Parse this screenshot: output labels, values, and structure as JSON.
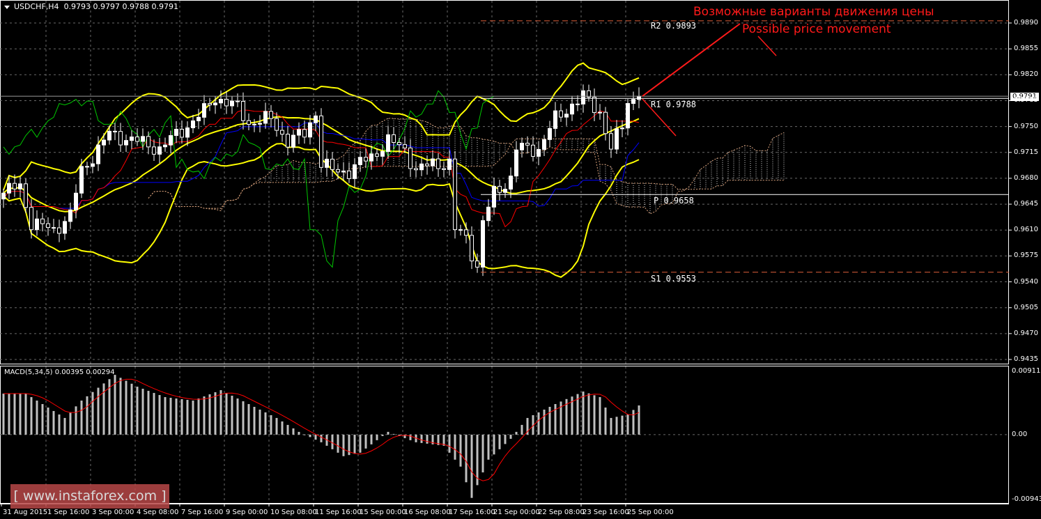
{
  "header": {
    "symbol": "USDCHF,H4",
    "ohlc": "0.9793 0.9797 0.9788 0.9791"
  },
  "annotation": {
    "ru": "Возможные варианты движения цены",
    "en": "Possible price movement"
  },
  "watermark": "[  www.instaforex.com ]",
  "current_price": "0.9791",
  "macd_label": "MACD(5,34,5) 0.00395 0.00294",
  "colors": {
    "bollinger": "#ffff00",
    "tenkan": "#ff0000",
    "kijun": "#0000ff",
    "chikou": "#00c800",
    "levels": "#e0603a",
    "annotation": "#ff1a1a",
    "macd_signal": "#ff0000",
    "macd_hist": "#c0c0c0"
  },
  "chart_data": {
    "type": "candlestick",
    "title": "USDCHF,H4",
    "price_axis": {
      "ticks": [
        "0.9890",
        "0.9855",
        "0.9820",
        "0.9785",
        "0.9750",
        "0.9715",
        "0.9680",
        "0.9645",
        "0.9610",
        "0.9575",
        "0.9540",
        "0.9505",
        "0.9470",
        "0.9435"
      ],
      "range": [
        0.9435,
        0.989
      ]
    },
    "time_axis": {
      "ticks": [
        "31 Aug 2015",
        "1 Sep 16:00",
        "3 Sep 00:00",
        "4 Sep 08:00",
        "7 Sep 16:00",
        "9 Sep 00:00",
        "10 Sep 08:00",
        "11 Sep 16:00",
        "15 Sep 00:00",
        "16 Sep 08:00",
        "17 Sep 16:00",
        "21 Sep 00:00",
        "22 Sep 08:00",
        "23 Sep 16:00",
        "25 Sep 00:00"
      ],
      "bars_per_tick": 8
    },
    "close_keypoints": [
      [
        0,
        0.966
      ],
      [
        3,
        0.967
      ],
      [
        5,
        0.962
      ],
      [
        9,
        0.961
      ],
      [
        12,
        0.963
      ],
      [
        14,
        0.969
      ],
      [
        19,
        0.974
      ],
      [
        24,
        0.973
      ],
      [
        28,
        0.972
      ],
      [
        32,
        0.9745
      ],
      [
        36,
        0.977
      ],
      [
        38,
        0.979
      ],
      [
        42,
        0.9775
      ],
      [
        44,
        0.9755
      ],
      [
        48,
        0.976
      ],
      [
        51,
        0.973
      ],
      [
        54,
        0.974
      ],
      [
        56,
        0.977
      ],
      [
        57,
        0.97
      ],
      [
        59,
        0.969
      ],
      [
        62,
        0.969
      ],
      [
        66,
        0.971
      ],
      [
        69,
        0.973
      ],
      [
        72,
        0.972
      ],
      [
        74,
        0.969
      ],
      [
        77,
        0.97
      ],
      [
        80,
        0.97
      ],
      [
        81,
        0.961
      ],
      [
        83,
        0.96
      ],
      [
        85,
        0.956
      ],
      [
        86,
        0.962
      ],
      [
        88,
        0.966
      ],
      [
        91,
        0.968
      ],
      [
        92,
        0.972
      ],
      [
        96,
        0.972
      ],
      [
        99,
        0.976
      ],
      [
        102,
        0.978
      ],
      [
        104,
        0.979
      ],
      [
        107,
        0.977
      ],
      [
        109,
        0.972
      ],
      [
        111,
        0.975
      ],
      [
        112,
        0.9785
      ],
      [
        114,
        0.9791
      ]
    ],
    "levels": [
      {
        "name": "R2",
        "label": "R2 0.9893",
        "value": 0.9893,
        "style": "dashed"
      },
      {
        "name": "R1",
        "label": "R1 0.9788",
        "value": 0.9788,
        "style": "solid"
      },
      {
        "name": "P",
        "label": "P 0.9658",
        "value": 0.9658,
        "style": "solid"
      },
      {
        "name": "S1",
        "label": "S1 0.9553",
        "value": 0.9553,
        "style": "dashed"
      }
    ],
    "indicators": [
      "Bollinger Bands(20,2)",
      "Ichimoku",
      "MACD(5,34,5)"
    ],
    "macd": {
      "axis_ticks": [
        "0.00911",
        "0.00",
        "-0.00943"
      ],
      "range": [
        -0.00943,
        0.00911
      ],
      "hist_keypoints": [
        [
          0,
          0.0059
        ],
        [
          4,
          0.0059
        ],
        [
          11,
          0.0024
        ],
        [
          14,
          0.0049
        ],
        [
          20,
          0.0086
        ],
        [
          24,
          0.0069
        ],
        [
          29,
          0.0054
        ],
        [
          34,
          0.0049
        ],
        [
          39,
          0.0064
        ],
        [
          44,
          0.0044
        ],
        [
          49,
          0.0024
        ],
        [
          53,
          0.0004
        ],
        [
          57,
          -0.0011
        ],
        [
          61,
          -0.0031
        ],
        [
          64,
          -0.0026
        ],
        [
          69,
          0.0004
        ],
        [
          74,
          -0.0011
        ],
        [
          79,
          -0.0016
        ],
        [
          82,
          -0.0046
        ],
        [
          84,
          -0.0091
        ],
        [
          87,
          -0.0036
        ],
        [
          91,
          -0.0006
        ],
        [
          94,
          0.0024
        ],
        [
          99,
          0.0044
        ],
        [
          104,
          0.0062
        ],
        [
          107,
          0.0054
        ],
        [
          109,
          0.0024
        ],
        [
          112,
          0.0029
        ],
        [
          114,
          0.0042
        ]
      ],
      "value": 0.00395,
      "signal": 0.00294
    }
  }
}
